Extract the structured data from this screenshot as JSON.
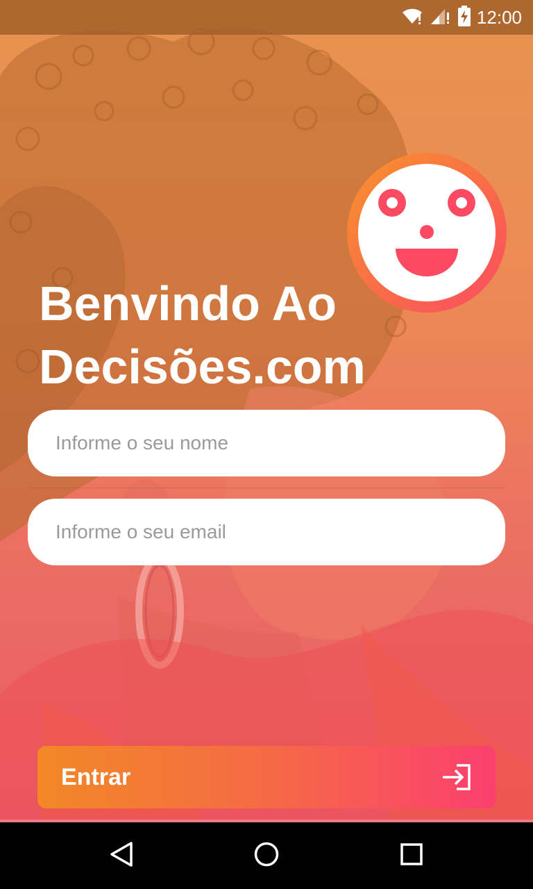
{
  "status_bar": {
    "time": "12:00",
    "icons": [
      "wifi-icon",
      "signal-icon",
      "battery-charging-icon"
    ]
  },
  "mascot": {
    "icon": "smiley-face-icon",
    "colors": {
      "ring_start": "#f7932b",
      "ring_end": "#fb4a62",
      "eyes": "#fb4a62"
    }
  },
  "welcome": {
    "line1": "Benvindo Ao",
    "line2": "Decisões.com"
  },
  "form": {
    "name_placeholder": "Informe o seu nome",
    "email_placeholder": "Informe o seu email"
  },
  "login_button": {
    "label": "Entrar",
    "icon": "login-arrow-icon",
    "colors": {
      "start": "#f28826",
      "end": "#fb3f6f"
    }
  },
  "nav_bar": {
    "buttons": [
      "back-icon",
      "home-icon",
      "recents-icon"
    ]
  }
}
